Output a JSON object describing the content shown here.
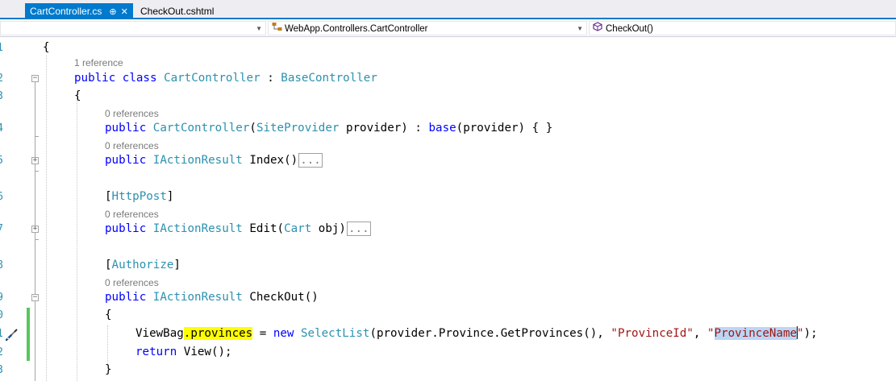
{
  "tabs": [
    {
      "label": "CartController.cs",
      "pin": "⊕",
      "close": "✕",
      "active": true
    },
    {
      "label": "CheckOut.cshtml",
      "active": false
    }
  ],
  "navbar": {
    "project_dropdown": "",
    "class_dropdown": "WebApp.Controllers.CartController",
    "member_dropdown": "CheckOut()"
  },
  "icons": {
    "pin": "pin-icon",
    "close": "close-icon",
    "class_icon": "class-icon",
    "method_icon": "method-icon",
    "quick_action": "screwdriver-icon"
  },
  "editor": {
    "line_numbers": [
      "1",
      "2",
      "3",
      "4",
      "5",
      "6",
      "7",
      "8",
      "9",
      "0",
      "1",
      "2",
      "3"
    ],
    "code_lens": {
      "class": "1 reference",
      "ctor": "0 references",
      "index": "0 references",
      "edit": "0 references",
      "checkout": "0 references"
    },
    "code": {
      "open_brace_ns": "{",
      "class_public": "public",
      "class_kw": "class",
      "class_name": "CartController",
      "class_colon": " : ",
      "class_base": "BaseController",
      "open_brace_class": "{",
      "ctor_public": "public",
      "ctor_name": "CartController",
      "ctor_paren_open": "(",
      "ctor_param_type": "SiteProvider",
      "ctor_param_rest": " provider) : ",
      "ctor_base": "base",
      "ctor_tail": "(provider) { }",
      "index_public": "public",
      "index_type": "IActionResult",
      "index_name": " Index()",
      "index_collapsed": "...",
      "attr_open": "[",
      "attr_httppost": "HttpPost",
      "attr_close": "]",
      "edit_public": "public",
      "edit_type": "IActionResult",
      "edit_name": " Edit(",
      "edit_param_type": "Cart",
      "edit_param_rest": " obj)",
      "edit_collapsed": "...",
      "attr2_open": "[",
      "attr_authorize": "Authorize",
      "attr2_close": "]",
      "co_public": "public",
      "co_type": "IActionResult",
      "co_name": " CheckOut()",
      "co_open": "{",
      "vb_viewbag": "ViewBag",
      "vb_provinces": ".provinces",
      "vb_eq": " = ",
      "vb_new": "new",
      "vb_selectlist": "SelectList",
      "vb_args": "(provider.Province.GetProvinces(), ",
      "vb_str1": "\"ProvinceId\"",
      "vb_comma": ", ",
      "vb_str2_q1": "\"",
      "vb_str2_name": "ProvinceName",
      "vb_str2_q2": "\"",
      "vb_end": ");",
      "ret_kw": "return",
      "ret_view": "View",
      "ret_end": "();",
      "co_close": "}"
    }
  },
  "colors": {
    "accent": "#007acc",
    "keyword": "#0000ff",
    "type": "#2b91af",
    "string": "#a31515",
    "highlight_yellow": "#ffff00",
    "highlight_selection": "#b9d7f5",
    "modified_bar": "#57c75a"
  }
}
